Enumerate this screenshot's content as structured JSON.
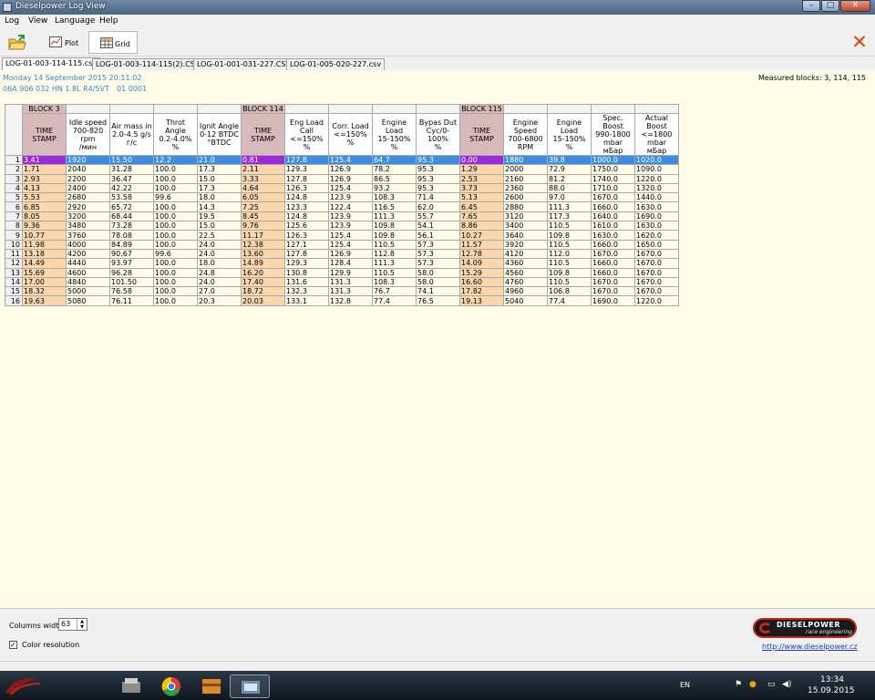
{
  "window": {
    "title": "Dieselpower Log View",
    "min": "–",
    "max": "□",
    "close": "✕"
  },
  "menu": [
    "Log",
    "View",
    "Language",
    "Help"
  ],
  "toolbar": {
    "plot_label": "Plot",
    "grid_label": "Grid"
  },
  "tabs": [
    "LOG-01-003-114-115.csv",
    "LOG-01-003-114-115(2).CSV",
    "LOG-01-001-031-227.CSV",
    "LOG-01-005-020-227.csv"
  ],
  "info": {
    "date": "Monday 14 September 2015 20:11:02",
    "part": "06A 906 032 HN  1.8L R4/5VT",
    "code": "01 0001",
    "measured_blocks": "Measured blocks: 3, 114, 115"
  },
  "grid": {
    "blocks": [
      "BLOCK 3",
      "BLOCK 114",
      "BLOCK 115"
    ],
    "headers": [
      [
        "TIME",
        "STAMP"
      ],
      [
        "Idle speed",
        "700-820 rpm",
        "/мин"
      ],
      [
        "Air mass in",
        "2.0-4.5 g/s",
        "г/с"
      ],
      [
        "Throt Angle",
        "0.2-4.0%",
        "%"
      ],
      [
        "Ignit Angle",
        "0-12 BTDC",
        "°BTDC"
      ],
      [
        "TIME",
        "STAMP"
      ],
      [
        "Eng Load",
        "Call",
        "<=150%",
        "%"
      ],
      [
        "Corr. Load",
        "<=150%",
        "%"
      ],
      [
        "Engine Load",
        "15-150%",
        "%"
      ],
      [
        "Bypas Dut",
        "Cyc/0-100%",
        "%"
      ],
      [
        "TIME",
        "STAMP"
      ],
      [
        "Engine",
        "Speed",
        "700-6800",
        "RPM"
      ],
      [
        "Engine Load",
        "15-150%",
        "%"
      ],
      [
        "Spec. Boost",
        "990-1800",
        "mbar",
        "мБар"
      ],
      [
        "Actual Boost",
        "<=1800 mbar",
        "мБар"
      ]
    ],
    "rows": [
      [
        "3.41",
        "1920",
        "15.50",
        "12.2",
        "21.0",
        "0.81",
        "127.8",
        "125.4",
        "64.7",
        "95.3",
        "0.00",
        "1880",
        "39.8",
        "1000.0",
        "1020.0"
      ],
      [
        "1.71",
        "2040",
        "31.28",
        "100.0",
        "17.3",
        "2.11",
        "129.3",
        "126.9",
        "78.2",
        "95.3",
        "1.29",
        "2000",
        "72.9",
        "1750.0",
        "1090.0"
      ],
      [
        "2.93",
        "2200",
        "36.47",
        "100.0",
        "15.0",
        "3.33",
        "127.8",
        "126.9",
        "86.5",
        "95.3",
        "2.53",
        "2160",
        "81.2",
        "1740.0",
        "1220.0"
      ],
      [
        "4.13",
        "2400",
        "42.22",
        "100.0",
        "17.3",
        "4.64",
        "126.3",
        "125.4",
        "93.2",
        "95.3",
        "3.73",
        "2360",
        "88.0",
        "1710.0",
        "1320.0"
      ],
      [
        "5.53",
        "2680",
        "53.58",
        "99.6",
        "18.0",
        "6.05",
        "124.8",
        "123.9",
        "108.3",
        "71.4",
        "5.13",
        "2600",
        "97.0",
        "1670.0",
        "1440.0"
      ],
      [
        "6.85",
        "2920",
        "65.72",
        "100.0",
        "14.3",
        "7.25",
        "123.3",
        "122.4",
        "116.5",
        "62.0",
        "6.45",
        "2880",
        "111.3",
        "1660.0",
        "1630.0"
      ],
      [
        "8.05",
        "3200",
        "68.44",
        "100.0",
        "19.5",
        "8.45",
        "124.8",
        "123.9",
        "111.3",
        "55.7",
        "7.65",
        "3120",
        "117.3",
        "1640.0",
        "1690.0"
      ],
      [
        "9.36",
        "3480",
        "73.28",
        "100.0",
        "15.0",
        "9.76",
        "125.6",
        "123.9",
        "109.8",
        "54.1",
        "8.86",
        "3400",
        "110.5",
        "1610.0",
        "1630.0"
      ],
      [
        "10.77",
        "3760",
        "78.08",
        "100.0",
        "22.5",
        "11.17",
        "126.3",
        "125.4",
        "109.8",
        "56.1",
        "10.27",
        "3640",
        "109.8",
        "1630.0",
        "1620.0"
      ],
      [
        "11.98",
        "4000",
        "84.89",
        "100.0",
        "24.0",
        "12.38",
        "127.1",
        "125.4",
        "110.5",
        "57.3",
        "11.57",
        "3920",
        "110.5",
        "1660.0",
        "1650.0"
      ],
      [
        "13.18",
        "4200",
        "90.67",
        "99.6",
        "24.0",
        "13.60",
        "127.8",
        "126.9",
        "112.8",
        "57.3",
        "12.78",
        "4120",
        "112.0",
        "1670.0",
        "1670.0"
      ],
      [
        "14.49",
        "4440",
        "93.97",
        "100.0",
        "18.0",
        "14.89",
        "129.3",
        "128.4",
        "111.3",
        "57.3",
        "14.09",
        "4360",
        "110.5",
        "1660.0",
        "1670.0"
      ],
      [
        "15.69",
        "4600",
        "96.28",
        "100.0",
        "24.8",
        "16.20",
        "130.8",
        "129.9",
        "110.5",
        "58.0",
        "15.29",
        "4560",
        "109.8",
        "1660.0",
        "1670.0"
      ],
      [
        "17.00",
        "4840",
        "101.50",
        "100.0",
        "24.0",
        "17.40",
        "131.6",
        "131.3",
        "108.3",
        "58.0",
        "16.60",
        "4760",
        "110.5",
        "1670.0",
        "1670.0"
      ],
      [
        "18.32",
        "5000",
        "76.58",
        "100.0",
        "27.0",
        "18.72",
        "132.3",
        "131.3",
        "76.7",
        "74.1",
        "17.82",
        "4960",
        "106.8",
        "1670.0",
        "1670.0"
      ],
      [
        "19.63",
        "5080",
        "76.11",
        "100.0",
        "20.3",
        "20.03",
        "133.1",
        "132.8",
        "77.4",
        "76.5",
        "19.13",
        "5040",
        "77.4",
        "1690.0",
        "1220.0"
      ]
    ]
  },
  "bottom": {
    "columns_width_label": "Columns width:",
    "columns_width_value": "63",
    "color_resolution_label": "Color resolution",
    "color_resolution_checked": "✓",
    "logo_brand": "DIESELPOWER",
    "logo_sub": "race engineering",
    "url": "http://www.dieselpower.cz"
  },
  "taskbar": {
    "lang": "EN",
    "time": "13:34",
    "date": "15.09.2015"
  },
  "colors": {
    "selected_row": "#3d8ee0",
    "timestamp_cell": "#fbd7ae",
    "grid_bg": "#fffde8",
    "accent_close": "#e4400f"
  }
}
